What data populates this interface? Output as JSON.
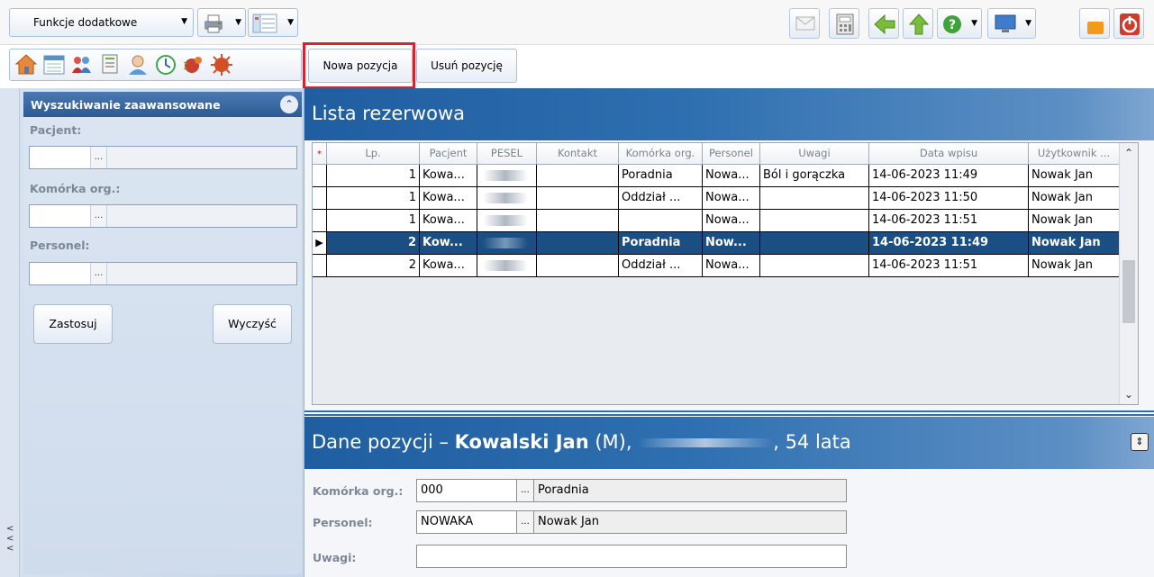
{
  "toolbar": {
    "functions_label": "Funkcje dodatkowe",
    "actions": [
      {
        "label": "Nowa pozycja",
        "highlighted": true
      },
      {
        "label": "Usuń pozycję",
        "highlighted": false
      }
    ],
    "nav_icons": [
      "home-icon",
      "calendar-icon",
      "people-icon",
      "documents-icon",
      "patient-icon",
      "refresh-icon",
      "bug-icon",
      "virus-icon"
    ],
    "right_icons": [
      "mail-icon",
      "calculator-icon",
      "back-arrow-icon",
      "up-arrow-icon",
      "help-icon",
      "monitor-icon",
      "lock-icon",
      "power-icon"
    ]
  },
  "search_panel": {
    "title": "Wyszukiwanie zaawansowane",
    "fields": [
      {
        "label": "Pacjent:",
        "value": ""
      },
      {
        "label": "Komórka org.:",
        "value": ""
      },
      {
        "label": "Personel:",
        "value": ""
      }
    ],
    "apply_label": "Zastosuj",
    "clear_label": "Wyczyść"
  },
  "list": {
    "title": "Lista rezerwowa",
    "columns": [
      "*",
      "Lp.",
      "Pacjent",
      "PESEL",
      "Kontakt",
      "Komórka org.",
      "Personel",
      "Uwagi",
      "Data wpisu",
      "Użytkownik ..."
    ],
    "rows": [
      {
        "lp": "1",
        "pacjent": "Kowa...",
        "kontakt": "",
        "komorka": "Poradnia",
        "personel": "Nowa...",
        "uwagi": "Ból i gorączka",
        "data": "14-06-2023 11:49",
        "uzytkownik": "Nowak Jan",
        "selected": false
      },
      {
        "lp": "1",
        "pacjent": "Kowa...",
        "kontakt": "",
        "komorka": "Oddział ...",
        "personel": "Nowa...",
        "uwagi": "",
        "data": "14-06-2023 11:50",
        "uzytkownik": "Nowak Jan",
        "selected": false
      },
      {
        "lp": "1",
        "pacjent": "Kowa...",
        "kontakt": "",
        "komorka": "",
        "personel": "Nowa...",
        "uwagi": "",
        "data": "14-06-2023 11:51",
        "uzytkownik": "Nowak Jan",
        "selected": false
      },
      {
        "lp": "2",
        "pacjent": "Kow...",
        "kontakt": "",
        "komorka": "Poradnia",
        "personel": "Now...",
        "uwagi": "",
        "data": "14-06-2023 11:49",
        "uzytkownik": "Nowak Jan",
        "selected": true
      },
      {
        "lp": "2",
        "pacjent": "Kowa...",
        "kontakt": "",
        "komorka": "Oddział ...",
        "personel": "Nowa...",
        "uwagi": "",
        "data": "14-06-2023 11:51",
        "uzytkownik": "Nowak Jan",
        "selected": false
      }
    ]
  },
  "details": {
    "prefix": "Dane pozycji – ",
    "patient_name": "Kowalski Jan",
    "sex": "(M),",
    "age": ", 54 lata",
    "komorka_label": "Komórka org.:",
    "komorka_code": "000",
    "komorka_name": "Poradnia",
    "personel_label": "Personel:",
    "personel_code": "NOWAKA",
    "personel_name": "Nowak Jan",
    "uwagi_label": "Uwagi:",
    "uwagi_value": ""
  },
  "colors": {
    "header_blue": "#1f5ea0",
    "selected_row": "#1b4f84",
    "highlight_red": "#d9232a"
  }
}
